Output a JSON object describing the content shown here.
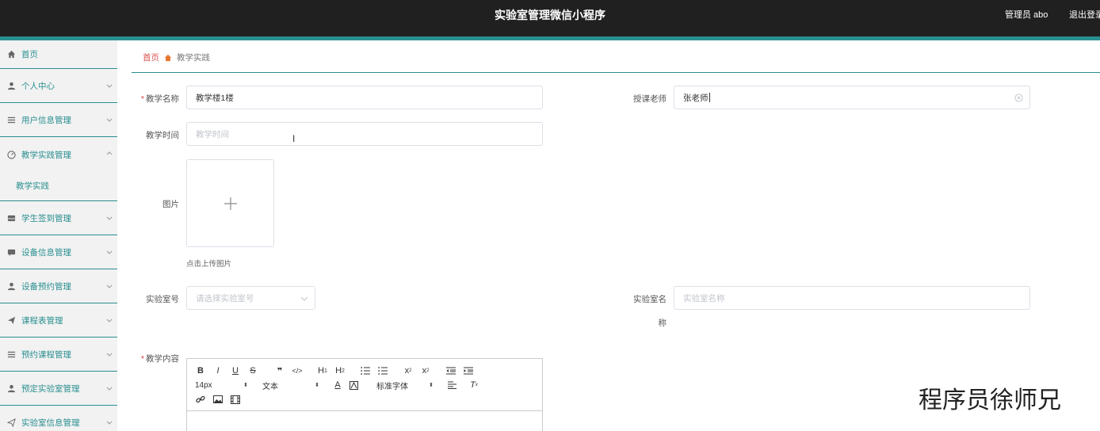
{
  "header": {
    "title": "实验室管理微信小程序",
    "admin": "管理员 abo",
    "logout": "退出登录"
  },
  "sidebar": {
    "items": [
      {
        "label": "首页",
        "icon": "home-icon"
      },
      {
        "label": "个人中心",
        "icon": "user-icon"
      },
      {
        "label": "用户信息管理",
        "icon": "list-icon"
      },
      {
        "label": "教学实践管理",
        "icon": "gauge-icon",
        "expanded": true
      },
      {
        "label": "教学实践",
        "sub": true
      },
      {
        "label": "学生签到管理",
        "icon": "inbox-icon"
      },
      {
        "label": "设备信息管理",
        "icon": "message-icon"
      },
      {
        "label": "设备预约管理",
        "icon": "user-icon"
      },
      {
        "label": "课程表管理",
        "icon": "send-icon"
      },
      {
        "label": "预约课程管理",
        "icon": "list-icon"
      },
      {
        "label": "预定实验室管理",
        "icon": "user-icon"
      },
      {
        "label": "实验室信息管理",
        "icon": "send-icon"
      }
    ]
  },
  "breadcrumb": {
    "home": "首页",
    "current": "教学实践"
  },
  "form": {
    "name_label": "教学名称",
    "name_value": "教学楼1楼",
    "teacher_label": "授课老师",
    "teacher_value": "张老师",
    "time_label": "教学时间",
    "time_placeholder": "教学时间",
    "image_label": "图片",
    "upload_hint": "点击上传图片",
    "lab_no_label": "实验室号",
    "lab_no_placeholder": "请选择实验室号",
    "lab_name_label_1": "实验室名",
    "lab_name_label_2": "称",
    "lab_name_placeholder": "实验室名称",
    "content_label": "教学内容"
  },
  "editor": {
    "font_size": "14px",
    "block_type": "文本",
    "font_family": "标准字体"
  },
  "watermark": "程序员徐师兄",
  "colors": {
    "accent": "#2a8f90",
    "header_bg": "#202020",
    "required": "#e4393c",
    "breadcrumb_home": "#d9534f"
  }
}
